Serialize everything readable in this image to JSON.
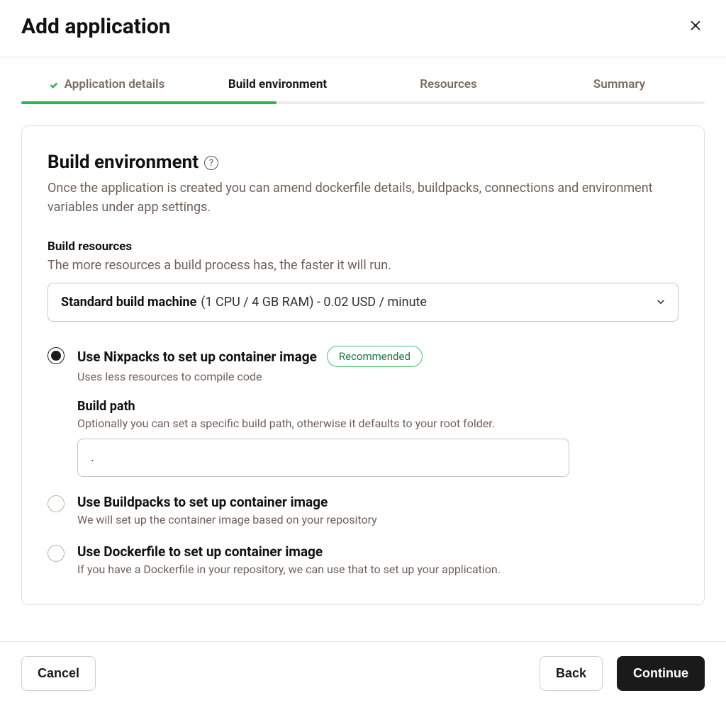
{
  "modal": {
    "title": "Add application"
  },
  "steps": {
    "items": [
      {
        "label": "Application details"
      },
      {
        "label": "Build environment"
      },
      {
        "label": "Resources"
      },
      {
        "label": "Summary"
      }
    ]
  },
  "section": {
    "title": "Build environment",
    "description": "Once the application is created you can amend dockerfile details, buildpacks, connections and environment variables under app settings."
  },
  "build_resources": {
    "title": "Build resources",
    "description": "The more resources a build process has, the faster it will run.",
    "select_bold": "Standard build machine",
    "select_rest": "(1 CPU / 4 GB RAM) - 0.02 USD / minute"
  },
  "options": {
    "nixpacks": {
      "title": "Use Nixpacks to set up container image",
      "badge": "Recommended",
      "desc": "Uses less resources to compile code",
      "build_path_title": "Build path",
      "build_path_desc": "Optionally you can set a specific build path, otherwise it defaults to your root folder.",
      "build_path_value": "."
    },
    "buildpacks": {
      "title": "Use Buildpacks to set up container image",
      "desc": "We will set up the container image based on your repository"
    },
    "dockerfile": {
      "title": "Use Dockerfile to set up container image",
      "desc": "If you have a Dockerfile in your repository, we can use that to set up your application."
    }
  },
  "footer": {
    "cancel": "Cancel",
    "back": "Back",
    "continue": "Continue"
  }
}
